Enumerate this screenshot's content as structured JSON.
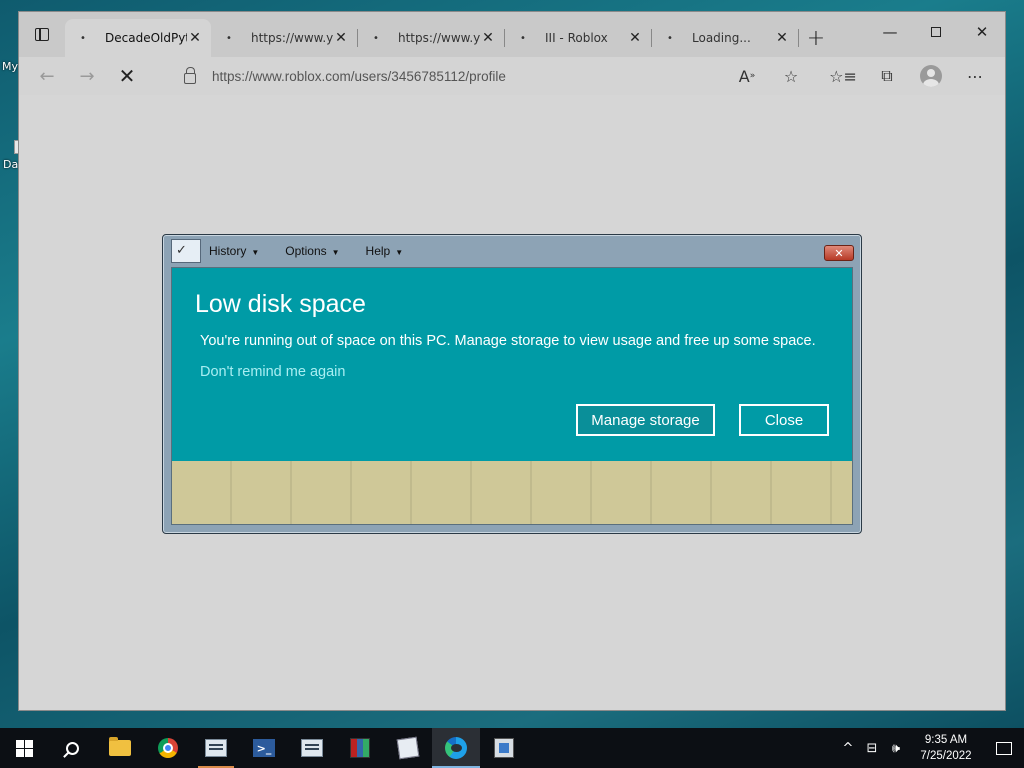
{
  "desktop": {
    "label_1": "My",
    "label_2": "Da"
  },
  "browser": {
    "tabs": [
      {
        "title": "DecadeOldPyth",
        "active": true
      },
      {
        "title": "https://www.yo",
        "active": false
      },
      {
        "title": "https://www.yo",
        "active": false
      },
      {
        "title": "III - Roblox",
        "active": false
      },
      {
        "title": "Loading...",
        "active": false
      }
    ],
    "url": "https://www.roblox.com/users/3456785112/profile"
  },
  "dialog": {
    "menus": [
      "History",
      "Options",
      "Help"
    ],
    "title": "Low disk space",
    "message": "You're running out of space on this PC. Manage storage to view usage and free up some space.",
    "link": "Don't remind me again",
    "primary_button": "Manage storage",
    "secondary_button": "Close"
  },
  "taskbar": {
    "time": "9:35 AM",
    "date": "7/25/2022"
  }
}
